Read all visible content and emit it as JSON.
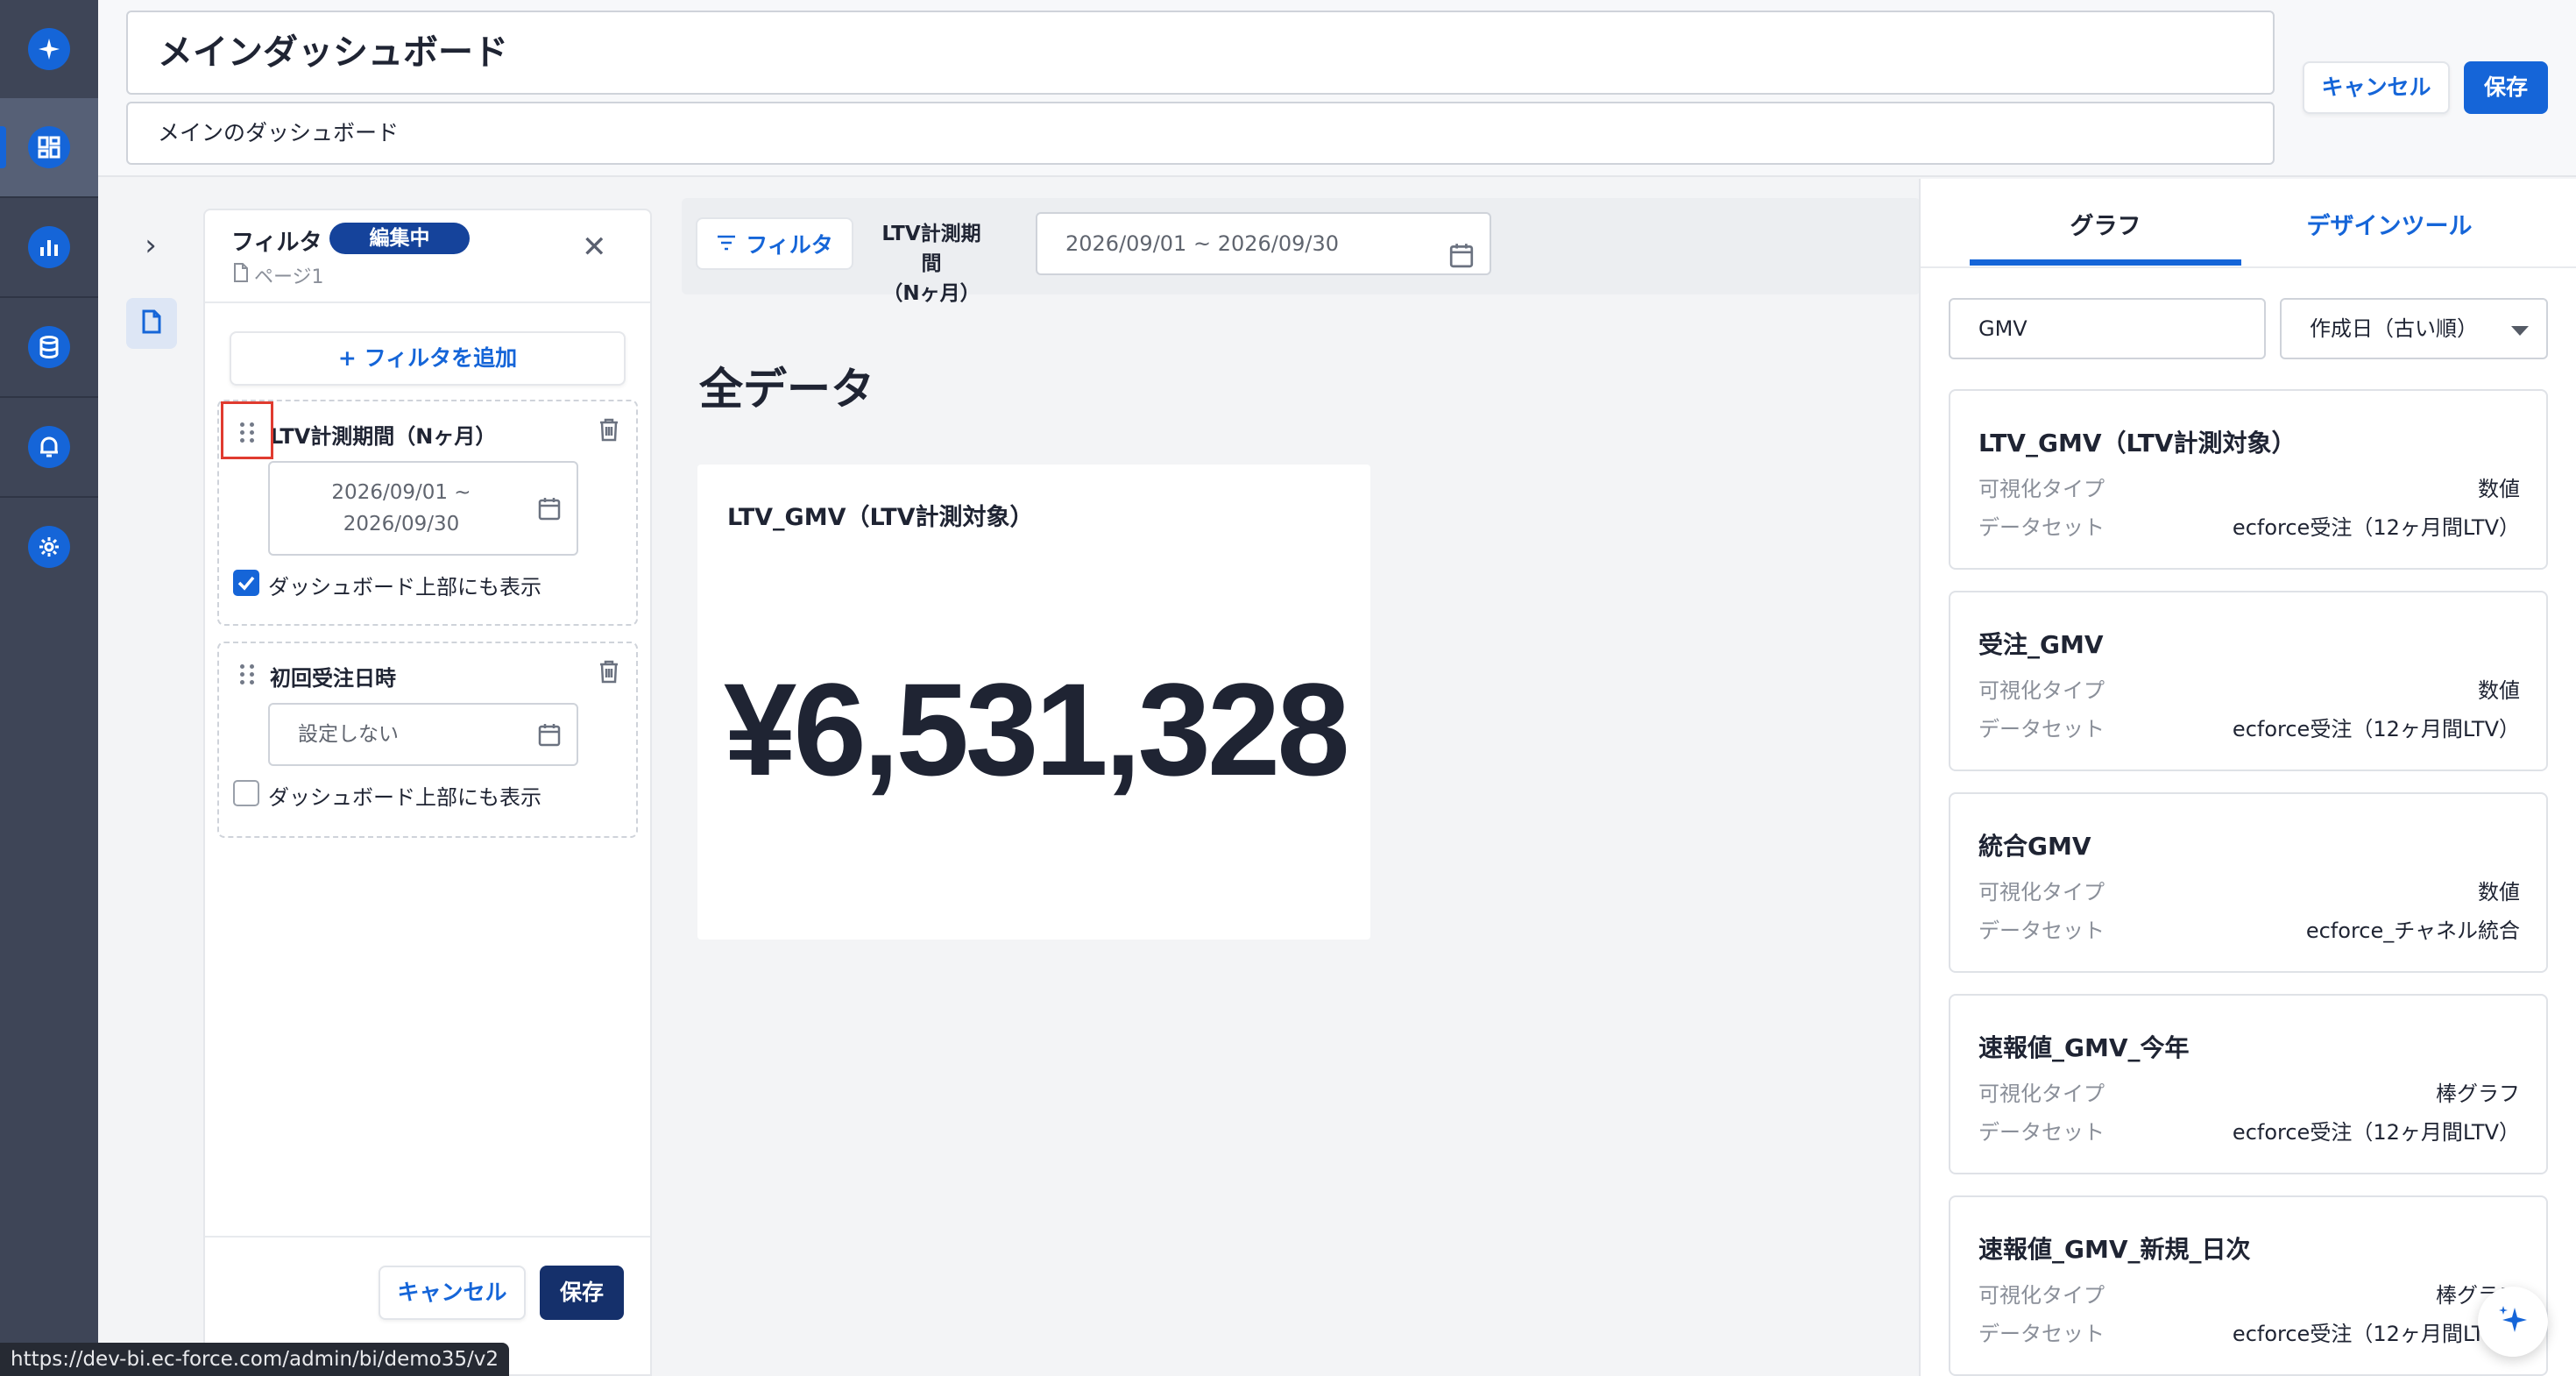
{
  "colors": {
    "brand": "#1565d8",
    "navy": "#15306b",
    "rail": "#3e4557",
    "highlight": "#e03b2f"
  },
  "nav": {
    "items": [
      {
        "name": "ai-assistant-icon"
      },
      {
        "name": "dashboard-icon",
        "active": true
      },
      {
        "name": "chart-icon"
      },
      {
        "name": "database-icon"
      },
      {
        "name": "bell-icon"
      },
      {
        "name": "gear-icon"
      }
    ]
  },
  "header": {
    "title": "メインダッシュボード",
    "description": "メインのダッシュボード",
    "cancel_label": "キャンセル",
    "save_label": "保存"
  },
  "filter_panel": {
    "title": "フィルタ",
    "badge": "編集中",
    "page": "ページ1",
    "add_filter_label": "+ フィルタを追加",
    "filters": [
      {
        "label": "LTV計測期間（Nヶ月）",
        "date_line1": "2026/09/01 ~",
        "date_line2": "2026/09/30",
        "show_on_top": true,
        "checkbox_label": "ダッシュボード上部にも表示"
      },
      {
        "label": "初回受注日時",
        "placeholder": "設定しない",
        "show_on_top": false,
        "checkbox_label": "ダッシュボード上部にも表示"
      }
    ],
    "cancel_label": "キャンセル",
    "save_label": "保存"
  },
  "toolbar": {
    "filter_label": "フィルタ",
    "period_line1": "LTV計測期間",
    "period_line2": "（Nヶ月）",
    "date_range": "2026/09/01 ~ 2026/09/30"
  },
  "main": {
    "section_title": "全データ",
    "kpi": {
      "title": "LTV_GMV（LTV計測対象）",
      "value": "¥6,531,328"
    }
  },
  "right_panel": {
    "tabs": [
      {
        "label": "グラフ",
        "active": true
      },
      {
        "label": "デザインツール",
        "active": false
      }
    ],
    "search_value": "GMV",
    "sort_value": "作成日（古い順）",
    "type_key": "可視化タイプ",
    "dataset_key": "データセット",
    "graphs": [
      {
        "title": "LTV_GMV（LTV計測対象）",
        "type": "数値",
        "dataset": "ecforce受注（12ヶ月間LTV）"
      },
      {
        "title": "受注_GMV",
        "type": "数値",
        "dataset": "ecforce受注（12ヶ月間LTV）"
      },
      {
        "title": "統合GMV",
        "type": "数値",
        "dataset": "ecforce_チャネル統合"
      },
      {
        "title": "速報値_GMV_今年",
        "type": "棒グラフ",
        "dataset": "ecforce受注（12ヶ月間LTV）"
      },
      {
        "title": "速報値_GMV_新規_日次",
        "type": "棒グラフ",
        "dataset": "ecforce受注（12ヶ月間LTV）"
      }
    ]
  },
  "status_bar": {
    "url": "https://dev-bi.ec-force.com/admin/bi/demo35/v2"
  }
}
